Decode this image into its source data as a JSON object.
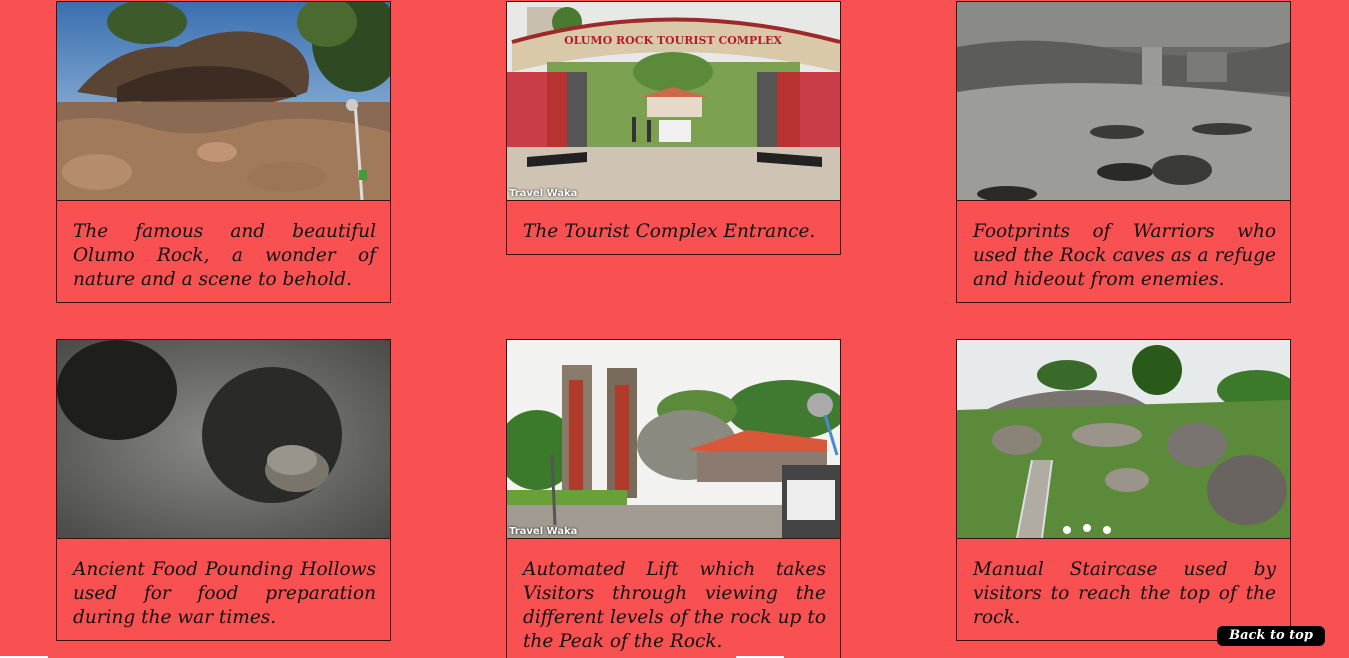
{
  "gallery": {
    "items": [
      {
        "caption": "The famous and beautiful Olumo Rock, a wonder of nature and a scene to behold."
      },
      {
        "caption": "The Tourist Complex Entrance.",
        "watermark": "Travel Waka",
        "sign_text": "OLUMO ROCK TOURIST COMPLEX"
      },
      {
        "caption": "Footprints of Warriors who used the Rock caves as a refuge and hideout from enemies."
      },
      {
        "caption": "Ancient Food Pounding Hollows used for food preparation during the war times."
      },
      {
        "caption": "Automated Lift which takes Visitors through viewing the different levels of the rock up to the Peak of the Rock.",
        "watermark": "Travel Waka"
      },
      {
        "caption": "Manual Staircase used by visitors to reach the top of the rock."
      }
    ]
  },
  "back_to_top": {
    "label": "Back to top"
  },
  "colors": {
    "page_background": "#f95052",
    "card_border": "#3a1010",
    "button_background": "#000000",
    "button_text": "#ffffff"
  }
}
